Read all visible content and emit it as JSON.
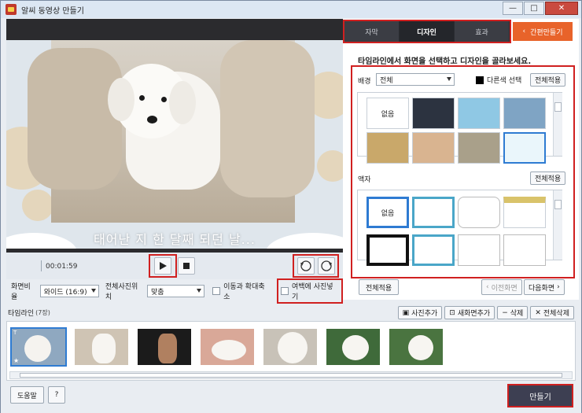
{
  "window": {
    "title": "알씨 동영상 만들기",
    "minimize": "—",
    "maximize": "□",
    "close": "✕"
  },
  "preview": {
    "caption": "태어난 지 한 달째 되던 날...",
    "time": "00:01:59"
  },
  "settings": {
    "ratio_label": "화면비율",
    "ratio_value": "와이드 (16:9)",
    "position_label": "전체사진위치",
    "position_value": "맞춤",
    "zoom_label": "이동과 확대축소",
    "fill_label": "여백에 사진넣기"
  },
  "right": {
    "tabs": [
      "자막",
      "디자인",
      "효과"
    ],
    "active_tab": 1,
    "easy_label": "간편만들기",
    "instruction": "타임라인에서 화면을 선택하고 디자인을 골라보세요.",
    "background_label": "배경",
    "background_select": "전체",
    "other_color": "다른색 선택",
    "apply_all": "전체적용",
    "none_label": "없음",
    "frame_label": "액자",
    "frame_apply_all": "전체적용",
    "frame_none": "없음",
    "bottom_apply_all": "전체적용",
    "prev_screen": "이전화면",
    "next_screen": "다음화면"
  },
  "timeline": {
    "label": "타임라인",
    "count": "(7장)",
    "add_photo": "사진추가",
    "new_screen": "새화면추가",
    "delete": "삭제",
    "delete_all": "전체삭제"
  },
  "bottom": {
    "help": "도움말",
    "question": "?",
    "make": "만들기"
  },
  "colors": {
    "accent_orange": "#e8632a",
    "highlight_red": "#d02020",
    "tab_dark": "#3b3d44",
    "make_button": "#3d3f52"
  }
}
